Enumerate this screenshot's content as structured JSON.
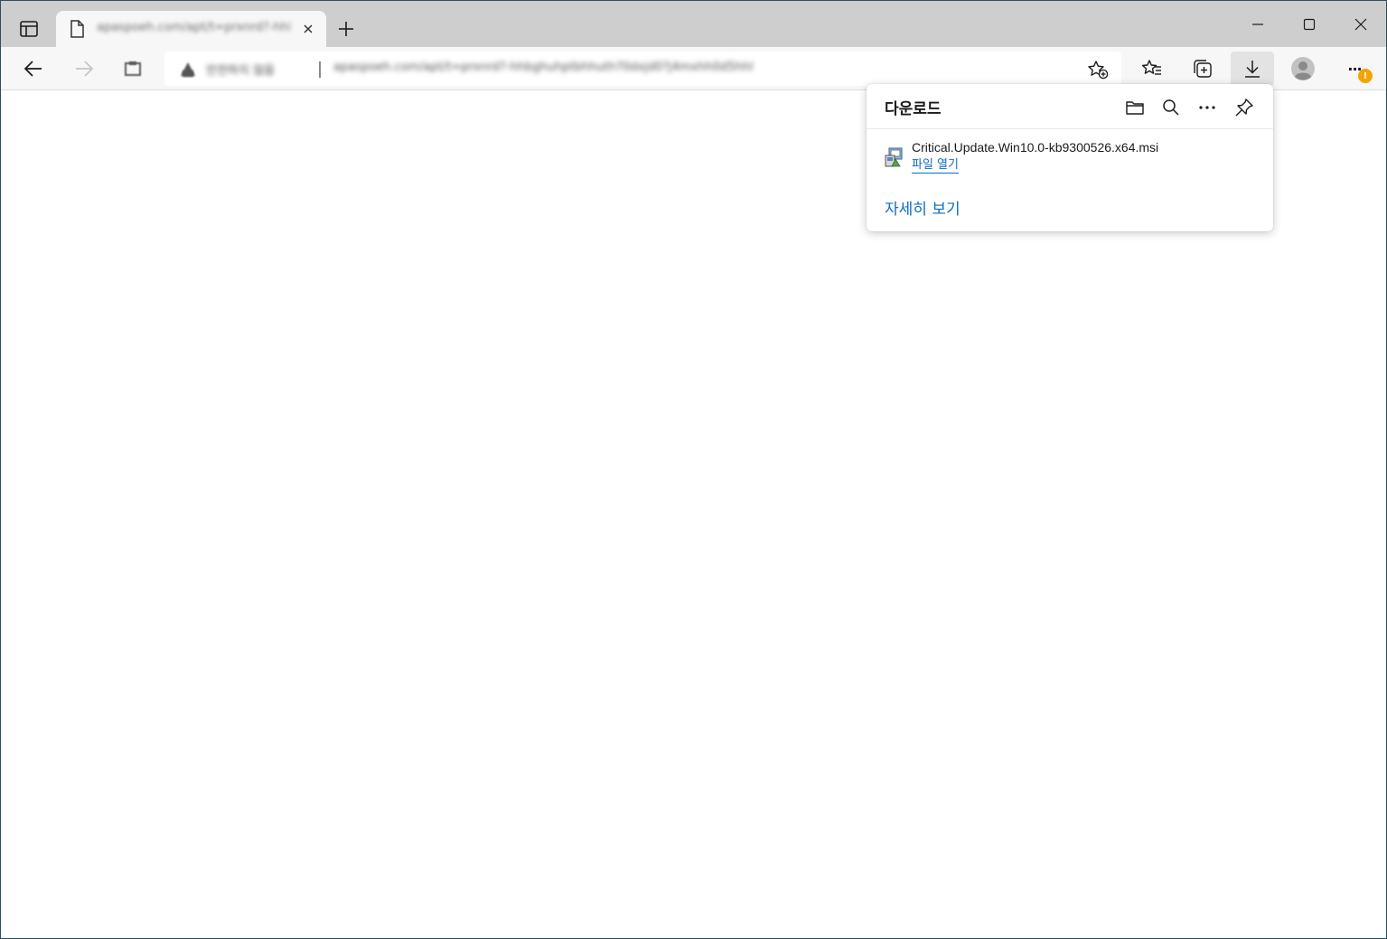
{
  "tab": {
    "title": "apaspoeh.com/apt/t=prxnrd?-hhbgkup",
    "close_glyph": "×"
  },
  "tabstrip": {
    "new_tab_glyph": "+"
  },
  "address": {
    "site_status": "안전하지 않음",
    "url": "apaspoeh.com/apt/t=prxnrd?-hhbghuhptbhhuth?0dxjd0?j4mxhh0d5hhl"
  },
  "toolbar": {
    "menu_glyph": "···",
    "badge": "!"
  },
  "downloads": {
    "title": "다운로드",
    "items": [
      {
        "filename": "Critical.Update.Win10.0-kb9300526.x64.msi",
        "action": "파일 열기"
      }
    ],
    "see_more": "자세히 보기"
  },
  "colors": {
    "accent": "#0f6cbd",
    "tabstrip": "#cecece",
    "toolbar": "#f7f7f7",
    "badge": "#f2a400"
  }
}
